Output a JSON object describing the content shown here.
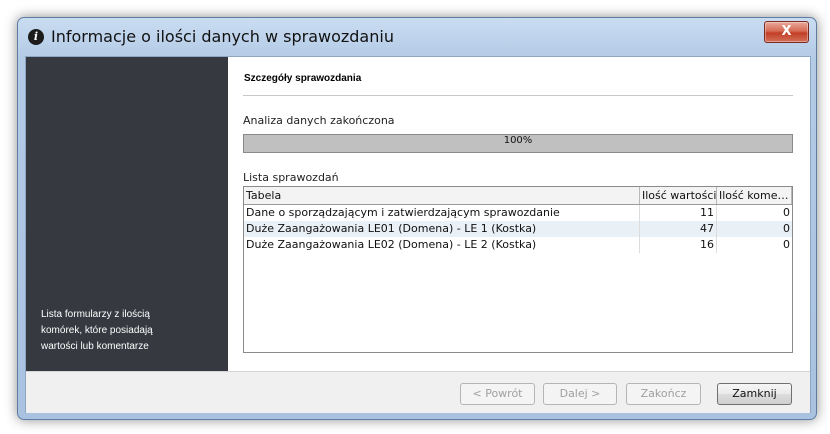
{
  "window": {
    "title": "Informacje o ilości danych w sprawozdaniu",
    "close_label": "X"
  },
  "sidebar": {
    "description": "Lista formularzy z ilością\nkomórek, które posiadają\nwartości lub komentarze"
  },
  "content": {
    "section_title": "Szczegóły sprawozdania",
    "analysis_label": "Analiza danych zakończona",
    "progress": {
      "value": 1.0,
      "text": "100%"
    },
    "list_label": "Lista sprawozdań",
    "table": {
      "columns": [
        "Tabela",
        "Ilość wartości",
        "Ilość komen..."
      ],
      "rows": [
        [
          "Dane o sporządzającym i zatwierdzającym sprawozdanie",
          "11",
          "0"
        ],
        [
          "Duże Zaangażowania LE01 (Domena) - LE 1 (Kostka)",
          "47",
          "0"
        ],
        [
          "Duże Zaangażowania LE02 (Domena) - LE 2 (Kostka)",
          "16",
          "0"
        ]
      ]
    }
  },
  "footer": {
    "back": "< Powrót",
    "next": "Dalej >",
    "finish": "Zakończ",
    "close": "Zamknij"
  }
}
